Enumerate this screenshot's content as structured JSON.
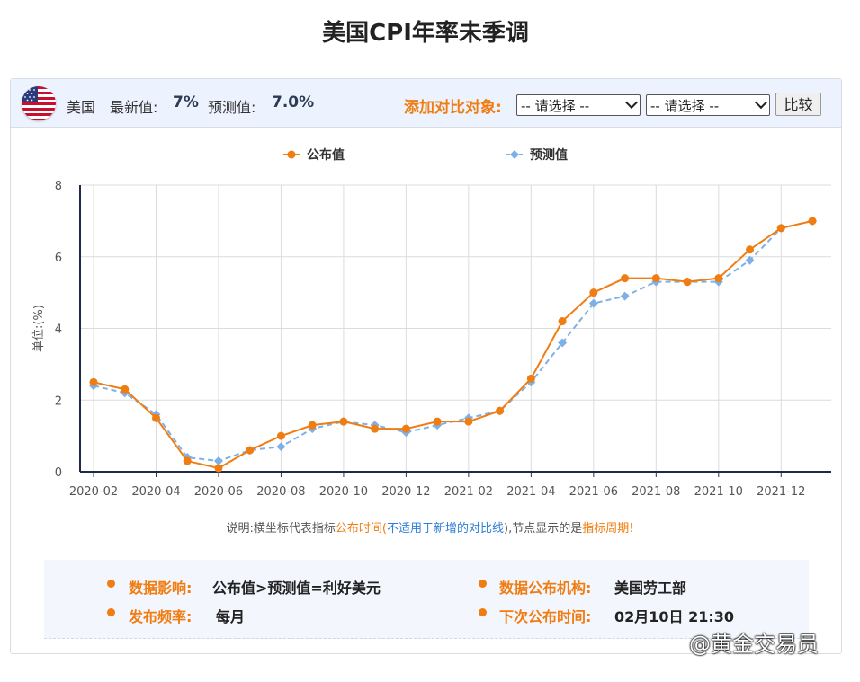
{
  "page_title": "美国CPI年率未季调",
  "header": {
    "country": "美国",
    "latest_label": "最新值:",
    "latest_value": "7%",
    "forecast_label": "预测值:",
    "forecast_value": "7.0%",
    "compare_label": "添加对比对象:",
    "select1_value": "-- 请选择 --",
    "select2_value": "-- 请选择 --",
    "compare_button": "比较",
    "flag_icon": "us-flag-icon"
  },
  "chart_data": {
    "type": "line",
    "ylabel": "单位:(%)",
    "ylim": [
      0,
      8
    ],
    "yticks": [
      0,
      2,
      4,
      6,
      8
    ],
    "x": [
      "2020-02",
      "2020-03",
      "2020-04",
      "2020-05",
      "2020-06",
      "2020-07",
      "2020-08",
      "2020-09",
      "2020-10",
      "2020-11",
      "2020-12",
      "2021-01",
      "2021-02",
      "2021-03",
      "2021-04",
      "2021-05",
      "2021-06",
      "2021-07",
      "2021-08",
      "2021-09",
      "2021-10",
      "2021-11",
      "2021-12",
      "2022-01"
    ],
    "xtick_labels": [
      "2020-02",
      "2020-04",
      "2020-06",
      "2020-08",
      "2020-10",
      "2020-12",
      "2021-02",
      "2021-04",
      "2021-06",
      "2021-08",
      "2021-10",
      "2021-12"
    ],
    "series": [
      {
        "name": "公布值",
        "color": "#f07d12",
        "style": "solid",
        "marker": "circle",
        "values": [
          2.5,
          2.3,
          1.5,
          0.3,
          0.1,
          0.6,
          1.0,
          1.3,
          1.4,
          1.2,
          1.2,
          1.4,
          1.4,
          1.7,
          2.6,
          4.2,
          5.0,
          5.4,
          5.4,
          5.3,
          5.4,
          6.2,
          6.8,
          7.0
        ]
      },
      {
        "name": "预测值",
        "color": "#7eb0e8",
        "style": "dashed",
        "marker": "diamond",
        "values": [
          2.4,
          2.2,
          1.6,
          0.4,
          0.3,
          0.6,
          0.7,
          1.2,
          1.4,
          1.3,
          1.1,
          1.3,
          1.5,
          1.7,
          2.5,
          3.6,
          4.7,
          4.9,
          5.3,
          5.3,
          5.3,
          5.9,
          6.8,
          7.0
        ]
      }
    ],
    "grid": true,
    "legend_position": "top"
  },
  "note": {
    "p1": "说明:横坐标代表指标",
    "p2": "公布时间",
    "p3": "(",
    "p4": "不适用于新增的对比线",
    "p5": "),节点显示的是",
    "p6": "指标周期",
    "p7": "!"
  },
  "info": {
    "impact_label": "数据影响:",
    "impact_value": "公布值>预测值=利好美元",
    "freq_label": "发布频率:",
    "freq_value": "每月",
    "org_label": "数据公布机构:",
    "org_value": "美国劳工部",
    "next_label": "下次公布时间:",
    "next_value": "02月10日 21:30"
  },
  "watermark": "@黄金交易员"
}
